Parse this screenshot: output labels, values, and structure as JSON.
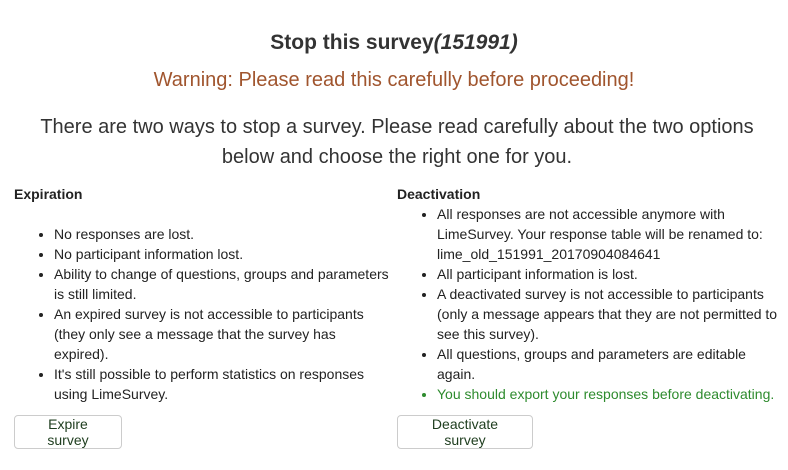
{
  "header": {
    "title": "Stop this survey",
    "survey_id": "(151991)"
  },
  "warning": {
    "text": "Warning: Please read this carefully before proceeding!",
    "color": "#a0552e"
  },
  "intro": {
    "text": "There are two ways to stop a survey. Please read carefully about the two options below and choose the right one for you."
  },
  "expiration": {
    "heading": "Expiration",
    "items": [
      "No responses are lost.",
      "No participant information lost.",
      "Ability to change of questions, groups and parameters is still limited.",
      "An expired survey is not accessible to participants (they only see a message that the survey has expired).",
      "It's still possible to perform statistics on responses using LimeSurvey."
    ],
    "button_label": "Expire survey"
  },
  "deactivation": {
    "heading": "Deactivation",
    "items": [
      "All responses are not accessible anymore with LimeSurvey. Your response table will be renamed to: lime_old_151991_20170904084641",
      "All participant information is lost.",
      "A deactivated survey is not accessible to participants (only a message appears that they are not permitted to see this survey).",
      "All questions, groups and parameters are editable again."
    ],
    "export_note": "You should export your responses before deactivating.",
    "export_note_color": "#2e8b2e",
    "button_label": "Deactivate survey"
  }
}
